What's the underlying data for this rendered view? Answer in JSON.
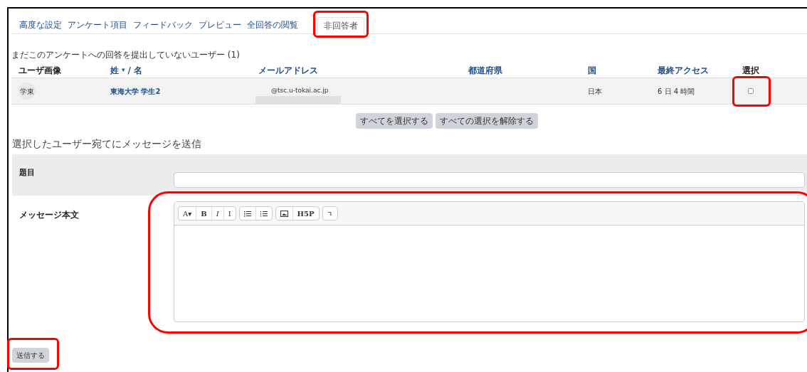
{
  "tabs": [
    {
      "label": "高度な設定",
      "selected": false
    },
    {
      "label": "アンケート項目",
      "selected": false
    },
    {
      "label": "フィードバック",
      "selected": false
    },
    {
      "label": "プレビュー",
      "selected": false
    },
    {
      "label": "全回答の閲覧",
      "selected": false
    },
    {
      "label": "非回答者",
      "selected": true
    }
  ],
  "caption": "まだこのアンケートへの回答を提出していないユーザー (1)",
  "table": {
    "columns": [
      {
        "label": "ユーザ画像",
        "link": false
      },
      {
        "label": "姓",
        "link": true,
        "sort": "▾",
        "extra": "/ 名"
      },
      {
        "label": "メールアドレス",
        "link": true
      },
      {
        "label": "都道府県",
        "link": true
      },
      {
        "label": "国",
        "link": true
      },
      {
        "label": "最終アクセス",
        "link": true
      },
      {
        "label": "選択",
        "link": false
      }
    ],
    "rows": [
      {
        "avatar": "学東",
        "name": "東海大学 学生2",
        "email": "@tsc.u-tokai.ac.jp",
        "email_redacted": true,
        "country": "日本",
        "last_access": "6 日 4 時間",
        "checked": false
      }
    ]
  },
  "select_buttons": [
    "すべてを選択する",
    "すべての選択を解除する"
  ],
  "heading": "選択したユーザー宛てにメッセージを送信",
  "subject": {
    "label": "題目"
  },
  "body": {
    "label": "メッセージ本文",
    "toolbar": [
      [
        {
          "kind": "text",
          "label": "A▾"
        },
        {
          "kind": "text",
          "label": "B"
        },
        {
          "kind": "text",
          "label": "I"
        },
        {
          "kind": "text",
          "label": "Ⅰ"
        }
      ],
      [
        {
          "kind": "bullet-list"
        },
        {
          "kind": "numbered-list"
        }
      ],
      [
        {
          "kind": "image"
        },
        {
          "kind": "text",
          "label": "H5P"
        }
      ],
      [
        {
          "kind": "text",
          "label": "↴"
        }
      ]
    ]
  },
  "send_button": "送信する"
}
